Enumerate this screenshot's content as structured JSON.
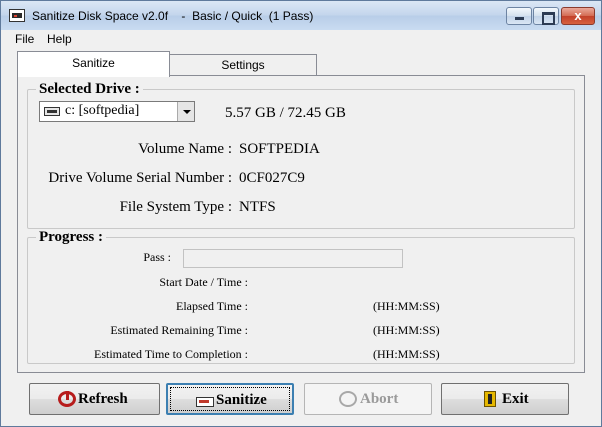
{
  "window": {
    "title": "Sanitize Disk Space v2.0f    -  Basic / Quick  (1 Pass)",
    "close_glyph": "x"
  },
  "menu": [
    "File",
    "Help"
  ],
  "tabs": [
    "Sanitize",
    "Settings"
  ],
  "selected_drive": {
    "group_title": "Selected Drive :",
    "drive_value": "c: [softpedia]",
    "size": "5.57 GB / 72.45 GB",
    "info": [
      {
        "label": "Volume Name :",
        "value": "SOFTPEDIA"
      },
      {
        "label": "Drive Volume Serial Number :",
        "value": "0CF027C9"
      },
      {
        "label": "File System Type :",
        "value": "NTFS"
      }
    ]
  },
  "progress": {
    "group_title": "Progress :",
    "pass_label": "Pass :",
    "rows": [
      {
        "label": "Start Date / Time :",
        "unit": ""
      },
      {
        "label": "Elapsed Time :",
        "unit": "(HH:MM:SS)"
      },
      {
        "label": "Estimated Remaining Time :",
        "unit": "(HH:MM:SS)"
      },
      {
        "label": "Estimated Time to Completion :",
        "unit": "(HH:MM:SS)"
      }
    ]
  },
  "buttons": {
    "refresh": "Refresh",
    "sanitize": "Sanitize",
    "abort": "Abort",
    "exit": "Exit"
  }
}
